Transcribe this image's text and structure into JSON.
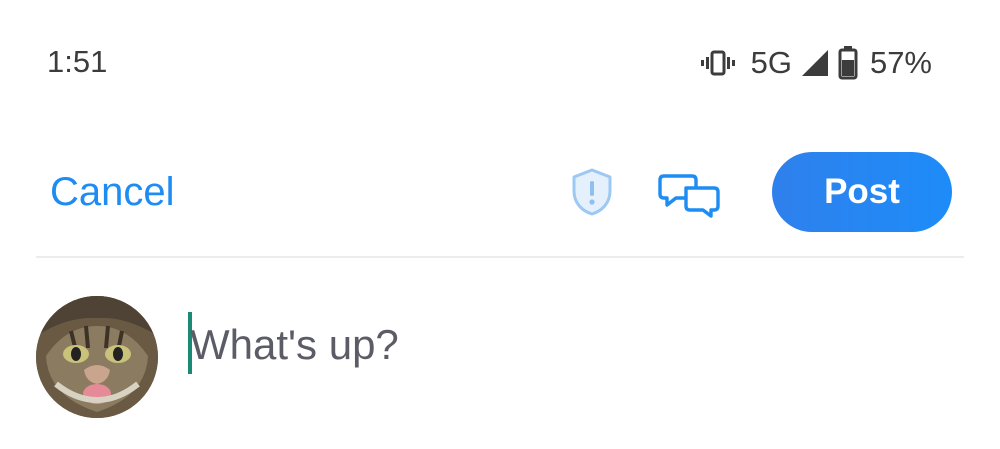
{
  "status_bar": {
    "time": "1:51",
    "network": "5G",
    "battery_percent": "57%",
    "icons": [
      "vibrate-icon",
      "signal-icon",
      "battery-icon"
    ]
  },
  "toolbar": {
    "cancel_label": "Cancel",
    "post_label": "Post",
    "icons": [
      "shield-alert-icon",
      "chat-bubbles-icon"
    ],
    "colors": {
      "accent": "#1d8cf3",
      "post_bg": "#2f80ec",
      "post_text": "#ffffff"
    }
  },
  "composer": {
    "placeholder": "What's up?",
    "value": "",
    "avatar": "cat-avatar"
  }
}
